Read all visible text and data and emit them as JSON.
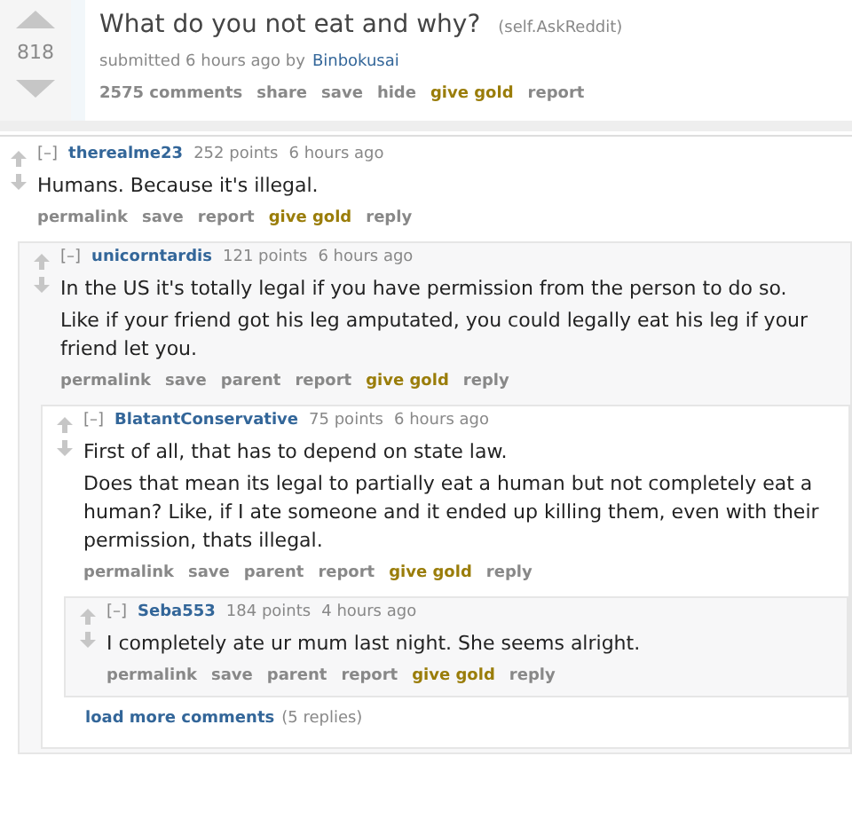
{
  "post": {
    "score": "818",
    "title": "What do you not eat and why?",
    "domain": "(self.AskReddit)",
    "submitted": "submitted 6 hours ago by",
    "author": "Binbokusai",
    "actions": [
      {
        "label": "2575 comments",
        "kind": "plain"
      },
      {
        "label": "share",
        "kind": "plain"
      },
      {
        "label": "save",
        "kind": "plain"
      },
      {
        "label": "hide",
        "kind": "plain"
      },
      {
        "label": "give gold",
        "kind": "gold"
      },
      {
        "label": "report",
        "kind": "plain"
      }
    ]
  },
  "comments": [
    {
      "toggle": "[–]",
      "author": "therealme23",
      "points": "252 points",
      "time": "6 hours ago",
      "body": [
        "Humans. Because it's illegal."
      ],
      "actions": [
        {
          "label": "permalink",
          "kind": "plain"
        },
        {
          "label": "save",
          "kind": "plain"
        },
        {
          "label": "report",
          "kind": "plain"
        },
        {
          "label": "give gold",
          "kind": "gold"
        },
        {
          "label": "reply",
          "kind": "plain"
        }
      ],
      "children": [
        {
          "toggle": "[–]",
          "author": "unicorntardis",
          "points": "121 points",
          "time": "6 hours ago",
          "body": [
            "In the US it's totally legal if you have permission from the person to do so.",
            "Like if your friend got his leg amputated, you could legally eat his leg if your friend let you."
          ],
          "actions": [
            {
              "label": "permalink",
              "kind": "plain"
            },
            {
              "label": "save",
              "kind": "plain"
            },
            {
              "label": "parent",
              "kind": "plain"
            },
            {
              "label": "report",
              "kind": "plain"
            },
            {
              "label": "give gold",
              "kind": "gold"
            },
            {
              "label": "reply",
              "kind": "plain"
            }
          ],
          "children": [
            {
              "toggle": "[–]",
              "author": "BlatantConservative",
              "points": "75 points",
              "time": "6 hours ago",
              "body": [
                "First of all, that has to depend on state law.",
                "Does that mean its legal to partially eat a human but not completely eat a human? Like, if I ate someone and it ended up killing them, even with their permission, thats illegal."
              ],
              "actions": [
                {
                  "label": "permalink",
                  "kind": "plain"
                },
                {
                  "label": "save",
                  "kind": "plain"
                },
                {
                  "label": "parent",
                  "kind": "plain"
                },
                {
                  "label": "report",
                  "kind": "plain"
                },
                {
                  "label": "give gold",
                  "kind": "gold"
                },
                {
                  "label": "reply",
                  "kind": "plain"
                }
              ],
              "children": [
                {
                  "toggle": "[–]",
                  "author": "Seba553",
                  "points": "184 points",
                  "time": "4 hours ago",
                  "body": [
                    "I completely ate ur mum last night. She seems alright."
                  ],
                  "actions": [
                    {
                      "label": "permalink",
                      "kind": "plain"
                    },
                    {
                      "label": "save",
                      "kind": "plain"
                    },
                    {
                      "label": "parent",
                      "kind": "plain"
                    },
                    {
                      "label": "report",
                      "kind": "plain"
                    },
                    {
                      "label": "give gold",
                      "kind": "gold"
                    },
                    {
                      "label": "reply",
                      "kind": "plain"
                    }
                  ]
                }
              ],
              "load_more": {
                "label": "load more comments",
                "count": "(5 replies)"
              }
            }
          ]
        }
      ]
    }
  ]
}
